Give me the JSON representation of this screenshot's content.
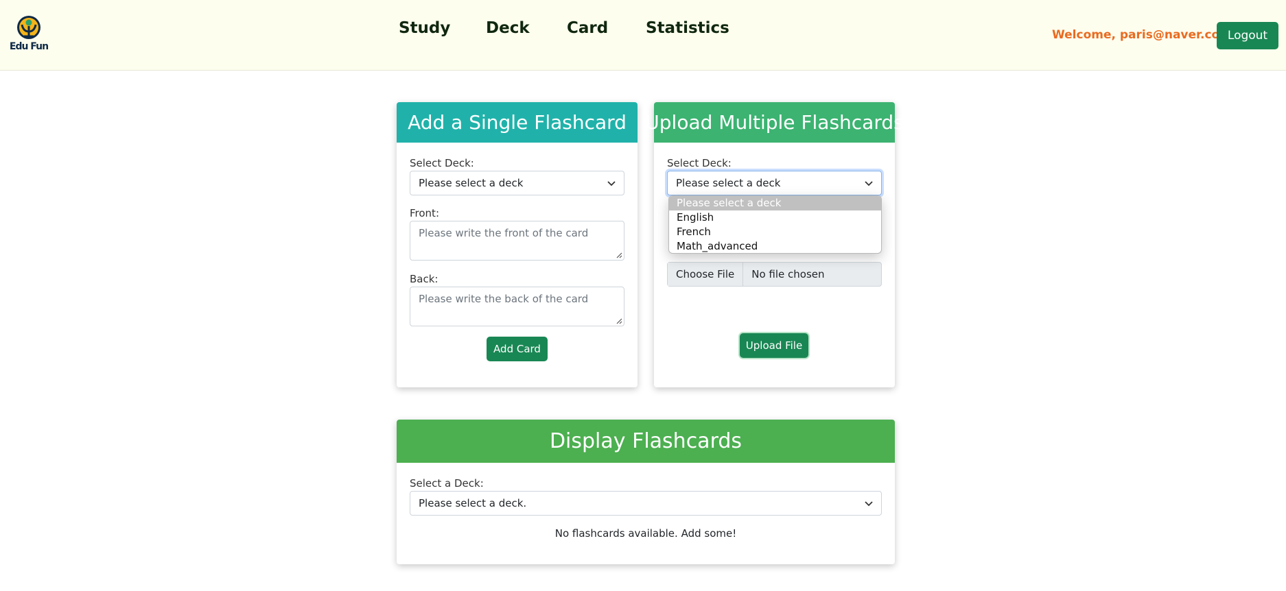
{
  "header": {
    "logo_text": "Edu Fun",
    "nav": [
      {
        "label": "Study"
      },
      {
        "label": "Deck"
      },
      {
        "label": "Card"
      },
      {
        "label": "Statistics"
      }
    ],
    "welcome": "Welcome, paris@naver.com!",
    "logout_label": "Logout"
  },
  "single_card": {
    "title": "Add a Single Flashcard",
    "deck_label": "Select Deck:",
    "deck_value": "Please select a deck",
    "front_label": "Front:",
    "front_placeholder": "Please write the front of the card",
    "back_label": "Back:",
    "back_placeholder": "Please write the back of the card",
    "add_button": "Add Card"
  },
  "multi_card": {
    "title": "Upload Multiple Flashcards",
    "deck_label": "Select Deck:",
    "deck_value": "Please select a deck",
    "options": [
      "Please select a deck",
      "English",
      "French",
      "Math_advanced"
    ],
    "choose_file": "Choose File",
    "file_status": "No file chosen",
    "upload_button": "Upload File"
  },
  "display": {
    "title": "Display Flashcards",
    "deck_label": "Select a Deck:",
    "deck_value": "Please select a deck.",
    "empty_message": "No flashcards available. Add some!"
  },
  "colors": {
    "single_header": "#20b2aa",
    "multi_header": "#3cb371",
    "display_header": "#4caf50",
    "button_green": "#198754",
    "welcome_orange": "#e96b21",
    "navbar_bg": "#fefeee"
  }
}
